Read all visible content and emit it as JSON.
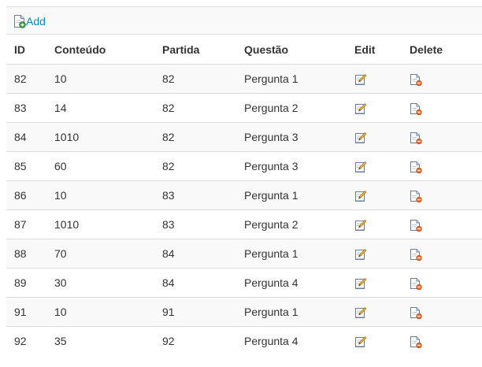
{
  "toolbar": {
    "add_label": "Add",
    "add_icon": "add-document-icon"
  },
  "columns": [
    "ID",
    "Conteúdo",
    "Partida",
    "Questão",
    "Edit",
    "Delete"
  ],
  "rows": [
    {
      "id": "82",
      "conteudo": "10",
      "partida": "82",
      "questao": "Pergunta 1"
    },
    {
      "id": "83",
      "conteudo": "14",
      "partida": "82",
      "questao": "Pergunta 2"
    },
    {
      "id": "84",
      "conteudo": "1010",
      "partida": "82",
      "questao": "Pergunta 3"
    },
    {
      "id": "85",
      "conteudo": "60",
      "partida": "82",
      "questao": "Pergunta 3"
    },
    {
      "id": "86",
      "conteudo": "10",
      "partida": "83",
      "questao": "Pergunta 1"
    },
    {
      "id": "87",
      "conteudo": "1010",
      "partida": "83",
      "questao": "Pergunta 2"
    },
    {
      "id": "88",
      "conteudo": "70",
      "partida": "84",
      "questao": "Pergunta 1"
    },
    {
      "id": "89",
      "conteudo": "30",
      "partida": "84",
      "questao": "Pergunta 4"
    },
    {
      "id": "91",
      "conteudo": "10",
      "partida": "91",
      "questao": "Pergunta 1"
    },
    {
      "id": "92",
      "conteudo": "35",
      "partida": "92",
      "questao": "Pergunta 4"
    }
  ],
  "icons": {
    "edit": "edit-pencil-icon",
    "delete": "delete-document-icon"
  },
  "colors": {
    "link": "#0088cc",
    "stripe": "#f9f9f9",
    "border": "#dddddd",
    "delete_badge": "#e8692a"
  }
}
